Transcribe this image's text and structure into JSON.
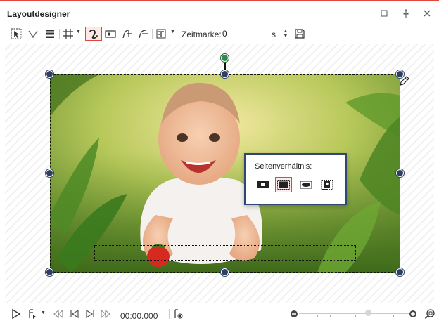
{
  "window": {
    "title": "Layoutdesigner",
    "accent_color": "#e0463c",
    "controls": [
      "maximize-icon",
      "pin-icon",
      "close-icon"
    ]
  },
  "toolbar": {
    "tools": [
      "select-tool-icon",
      "anchor-tool-icon",
      "layout-bars-icon",
      "grid-icon",
      "curve-path-icon",
      "camera-pan-icon",
      "text-flow-icon",
      "text-path-icon",
      "text-format-icon"
    ],
    "active_tool": "curve-path-icon",
    "zeit_label": "Zeitmarke:",
    "zeit_value": "0",
    "zeit_unit": "s",
    "save_icon": "save-icon"
  },
  "popup": {
    "label": "Seitenverhältnis:",
    "options": [
      "aspect-original-icon",
      "aspect-fill-icon",
      "aspect-fit-icon",
      "aspect-portrait-icon"
    ],
    "active_option": "aspect-fill-icon",
    "border_color": "#2f4774"
  },
  "transport": {
    "timecode": "00:00.000",
    "buttons": [
      "play-icon",
      "marker-icon",
      "first-icon",
      "prev-icon",
      "next-icon",
      "last-icon",
      "record-marker-icon",
      "zoom-out-icon",
      "zoom-in-icon",
      "zoom-fit-icon"
    ]
  }
}
